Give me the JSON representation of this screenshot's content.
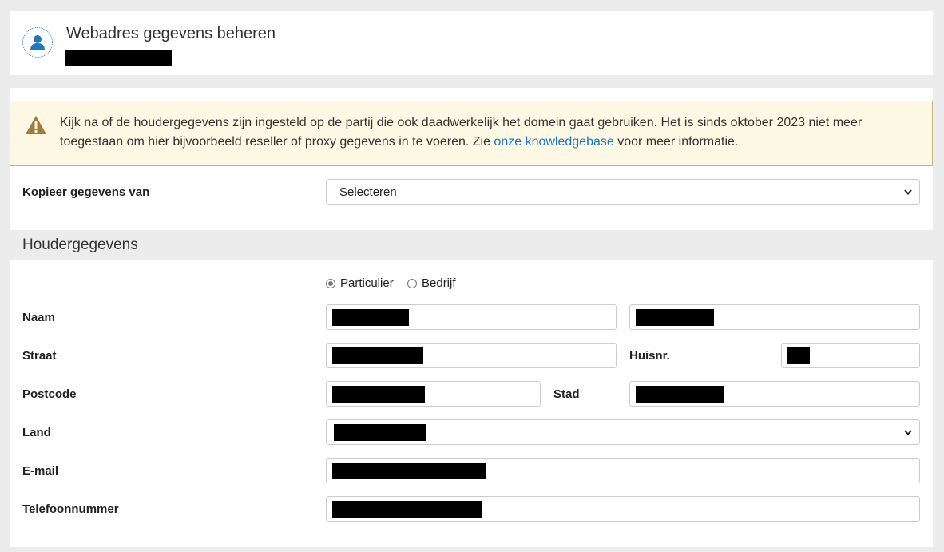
{
  "header": {
    "title": "Webadres gegevens beheren",
    "avatar_icon": "user-icon"
  },
  "alert": {
    "icon": "warning-triangle-icon",
    "text_before": "Kijk na of de houdergegevens zijn ingesteld op de partij die ook daadwerkelijk het domein gaat gebruiken. Het is sinds oktober 2023 niet meer toegestaan om hier bijvoorbeeld reseller of proxy gegevens in te voeren. Zie ",
    "link_text": "onze knowledgebase",
    "text_after": " voor meer informatie."
  },
  "copy": {
    "label": "Kopieer gegevens van",
    "selected": "Selecteren"
  },
  "holder": {
    "heading": "Houdergegevens",
    "type_options": [
      {
        "label": "Particulier",
        "checked": true
      },
      {
        "label": "Bedrijf",
        "checked": false
      }
    ],
    "labels": {
      "name": "Naam",
      "street": "Straat",
      "house_number": "Huisnr.",
      "postcode": "Postcode",
      "city": "Stad",
      "country": "Land",
      "email": "E-mail",
      "phone": "Telefoonnummer"
    }
  },
  "colors": {
    "accent": "#1d78c1",
    "alert_bg": "#fcf8e3",
    "alert_icon": "#a07c3a"
  }
}
